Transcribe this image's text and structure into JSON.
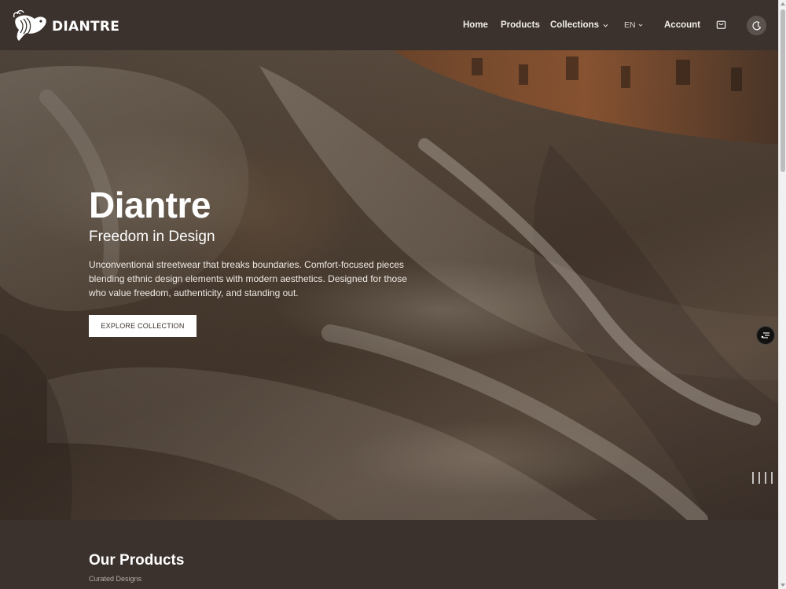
{
  "brand": {
    "name": "DIANTRE",
    "logo_icon": "betta-fish-icon"
  },
  "nav": {
    "home": "Home",
    "products": "Products",
    "collections": "Collections",
    "language": "EN",
    "account": "Account",
    "cart_icon": "shopping-bag-icon",
    "theme_icon": "moon-icon"
  },
  "hero": {
    "title": "Diantre",
    "subtitle": "Freedom in Design",
    "description": "Unconventional streetwear that breaks boundaries. Comfort-focused pieces blending ethnic design elements with modern aesthetics. Designed for those who value freedom, authenticity, and standing out.",
    "cta": "EXPLORE COLLECTION",
    "filter_icon": "filter-icon",
    "slide_count": 4
  },
  "products": {
    "title": "Our Products",
    "subtitle": "Curated Designs"
  },
  "colors": {
    "header_bg": "#3b322e",
    "accent": "#ffffff",
    "section_bg": "#3b322e"
  }
}
